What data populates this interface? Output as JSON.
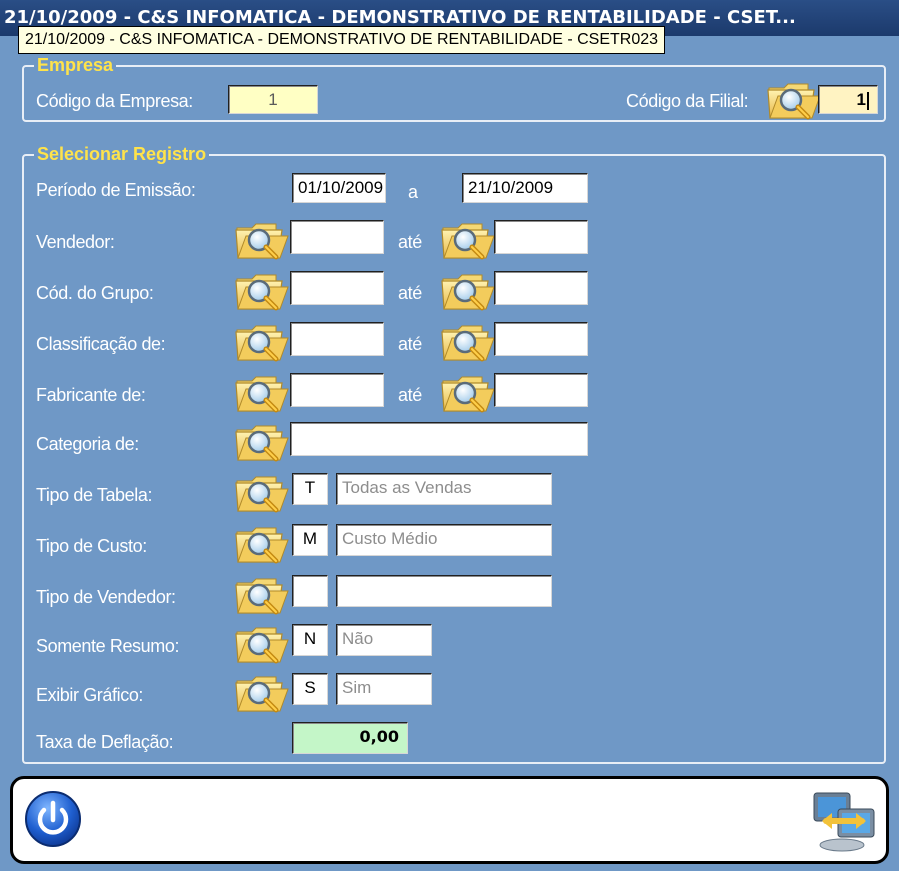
{
  "window": {
    "title": "21/10/2009  -  C&S INFOMATICA  -  DEMONSTRATIVO DE RENTABILIDADE  -  CSET...",
    "tooltip": "21/10/2009  -  C&S INFOMATICA  -  DEMONSTRATIVO DE RENTABILIDADE  -  CSETR023"
  },
  "empresa": {
    "legend": "Empresa",
    "codigo_empresa_label": "Código da Empresa:",
    "codigo_empresa_value": "1",
    "codigo_filial_label": "Código da Filial:",
    "codigo_filial_value": "1"
  },
  "registro": {
    "legend": "Selecionar Registro",
    "periodo": {
      "label": "Período de Emissão:",
      "from": "01/10/2009",
      "sep": "a",
      "to": "21/10/2009"
    },
    "vendedor": {
      "label": "Vendedor:",
      "from": "",
      "ate": "até",
      "to": ""
    },
    "grupo": {
      "label": "Cód. do Grupo:",
      "from": "",
      "ate": "até",
      "to": ""
    },
    "classificacao": {
      "label": "Classificação de:",
      "from": "",
      "ate": "até",
      "to": ""
    },
    "fabricante": {
      "label": "Fabricante de:",
      "from": "",
      "ate": "até",
      "to": ""
    },
    "categoria": {
      "label": "Categoria de:",
      "value": ""
    },
    "tipo_tabela": {
      "label": "Tipo de Tabela:",
      "code": "T",
      "desc": "Todas as Vendas"
    },
    "tipo_custo": {
      "label": "Tipo de Custo:",
      "code": "M",
      "desc": "Custo Médio"
    },
    "tipo_vendedor": {
      "label": "Tipo de Vendedor:",
      "code": "",
      "desc": ""
    },
    "somente_resumo": {
      "label": "Somente Resumo:",
      "code": "N",
      "desc": "Não"
    },
    "exibir_grafico": {
      "label": "Exibir Gráfico:",
      "code": "S",
      "desc": "Sim"
    },
    "taxa_deflacao": {
      "label": "Taxa de Deflação:",
      "value": "0,00"
    }
  },
  "icons": {
    "search": "search-folder-icon",
    "power": "power-icon",
    "transfer": "transfer-computers-icon"
  },
  "colors": {
    "background": "#6f98c6",
    "legend_text": "#ffe34a",
    "title_bar": "#1c3a6c"
  }
}
